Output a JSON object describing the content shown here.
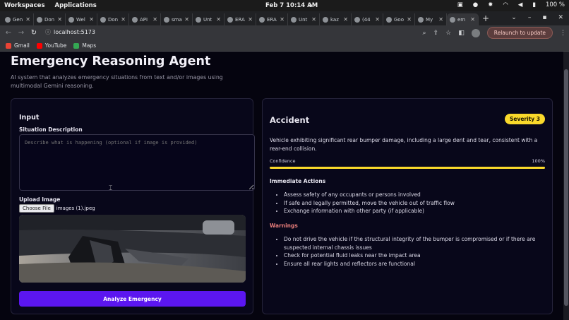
{
  "os": {
    "menus": [
      "Workspaces",
      "Applications"
    ],
    "clock": "Feb 7  10:14 AM",
    "battery": "100 %"
  },
  "browser": {
    "tabs": [
      {
        "title": "Gen"
      },
      {
        "title": "Don"
      },
      {
        "title": "Wel"
      },
      {
        "title": "Don"
      },
      {
        "title": "API"
      },
      {
        "title": "sma"
      },
      {
        "title": "Unt"
      },
      {
        "title": "ERA"
      },
      {
        "title": "ERA"
      },
      {
        "title": "Unt"
      },
      {
        "title": "kaz"
      },
      {
        "title": "(44"
      },
      {
        "title": "Goo"
      },
      {
        "title": "My"
      },
      {
        "title": "em"
      }
    ],
    "url": "localhost:5173",
    "relaunch_label": "Relaunch to update",
    "bookmarks": [
      "Gmail",
      "YouTube",
      "Maps"
    ]
  },
  "app": {
    "title": "Emergency Reasoning Agent",
    "subtitle": "AI system that analyzes emergency situations from text and/or images using multimodal Gemini reasoning.",
    "input": {
      "heading": "Input",
      "situation_label": "Situation Description",
      "situation_placeholder": "Describe what is happening (optional if image is provided)",
      "upload_label": "Upload Image",
      "choose_file": "Choose File",
      "file_name": "images (1).jpeg",
      "analyze_label": "Analyze Emergency"
    },
    "result": {
      "type": "Accident",
      "severity": "Severity 3",
      "description": "Vehicle exhibiting significant rear bumper damage, including a large dent and tear, consistent with a rear-end collision.",
      "confidence_label": "Confidence",
      "confidence_text": "100%",
      "confidence_value": 1.0,
      "actions_heading": "Immediate Actions",
      "actions": [
        "Assess safety of any occupants or persons involved",
        "If safe and legally permitted, move the vehicle out of traffic flow",
        "Exchange information with other party (if applicable)"
      ],
      "warnings_heading": "Warnings",
      "warnings": [
        "Do not drive the vehicle if the structural integrity of the bumper is compromised or if there are suspected internal chassis issues",
        "Check for potential fluid leaks near the impact area",
        "Ensure all rear lights and reflectors are functional"
      ]
    }
  },
  "colors": {
    "accent": "#5b16f0",
    "severity": "#fad92b",
    "warning": "#e67c7a",
    "background": "#05040f"
  }
}
